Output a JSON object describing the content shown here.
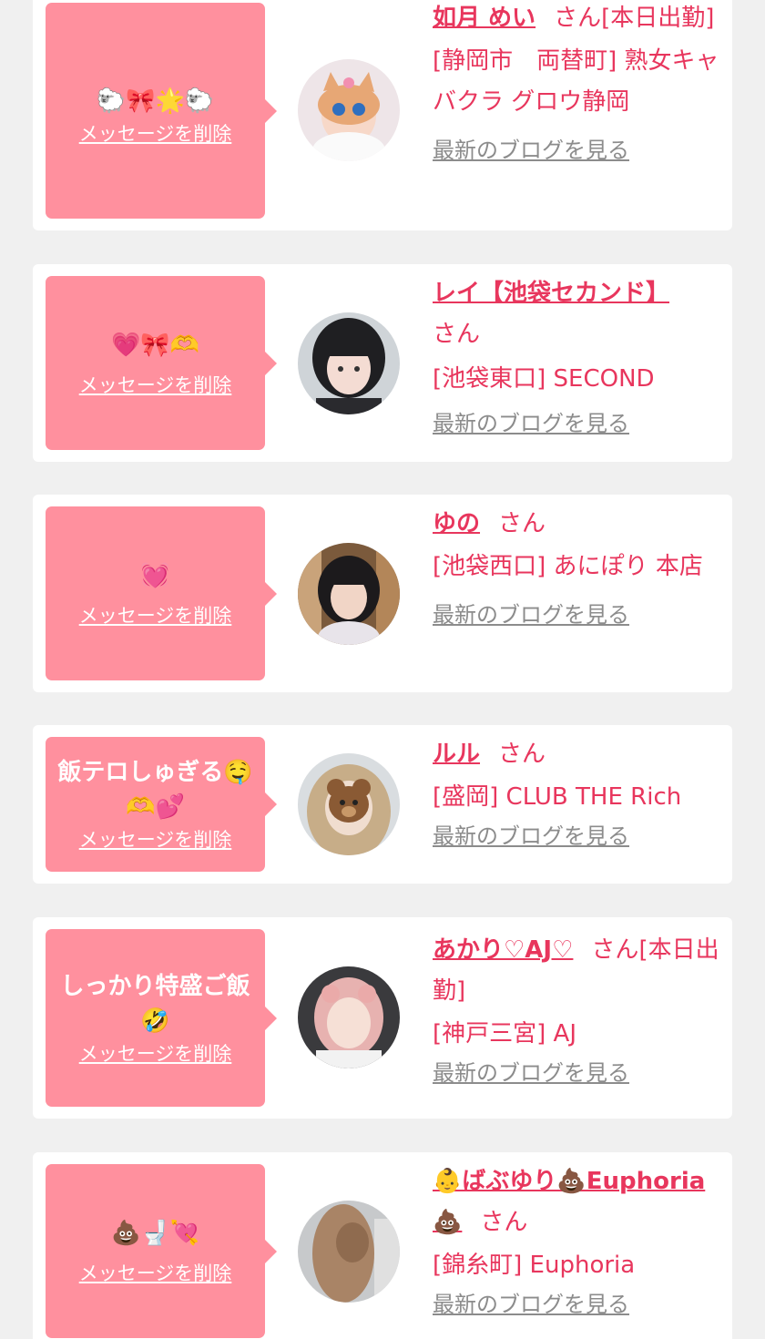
{
  "ui": {
    "san": "さん",
    "delete_label": "メッセージを削除",
    "blog_label": "最新のブログを見る"
  },
  "items": [
    {
      "message": "🐑🎀🌟🐑",
      "name": "如月 めい",
      "suffix": "[本日出勤]",
      "shop": "[静岡市　両替町] 熟女キャバクラ グロウ静岡"
    },
    {
      "message": "💗🎀🫶",
      "name": "レイ【池袋セカンド】",
      "suffix": "",
      "shop": "[池袋東口] SECOND"
    },
    {
      "message": "💓",
      "name": "ゆの",
      "suffix": "",
      "shop": "[池袋西口] あにぽり 本店"
    },
    {
      "message": "飯テロしゅぎる🤤🫶💕",
      "name": "ルル",
      "suffix": "",
      "shop": "[盛岡] CLUB THE Rich"
    },
    {
      "message": "しっかり特盛ご飯🤣",
      "name": "あかり♡AJ♡",
      "suffix": "[本日出勤]",
      "shop": "[神戸三宮] AJ"
    },
    {
      "message": "💩🚽💘",
      "name": "👶ばぶゆり💩Euphoria💩",
      "suffix": "",
      "shop": "[錦糸町] Euphoria"
    }
  ]
}
